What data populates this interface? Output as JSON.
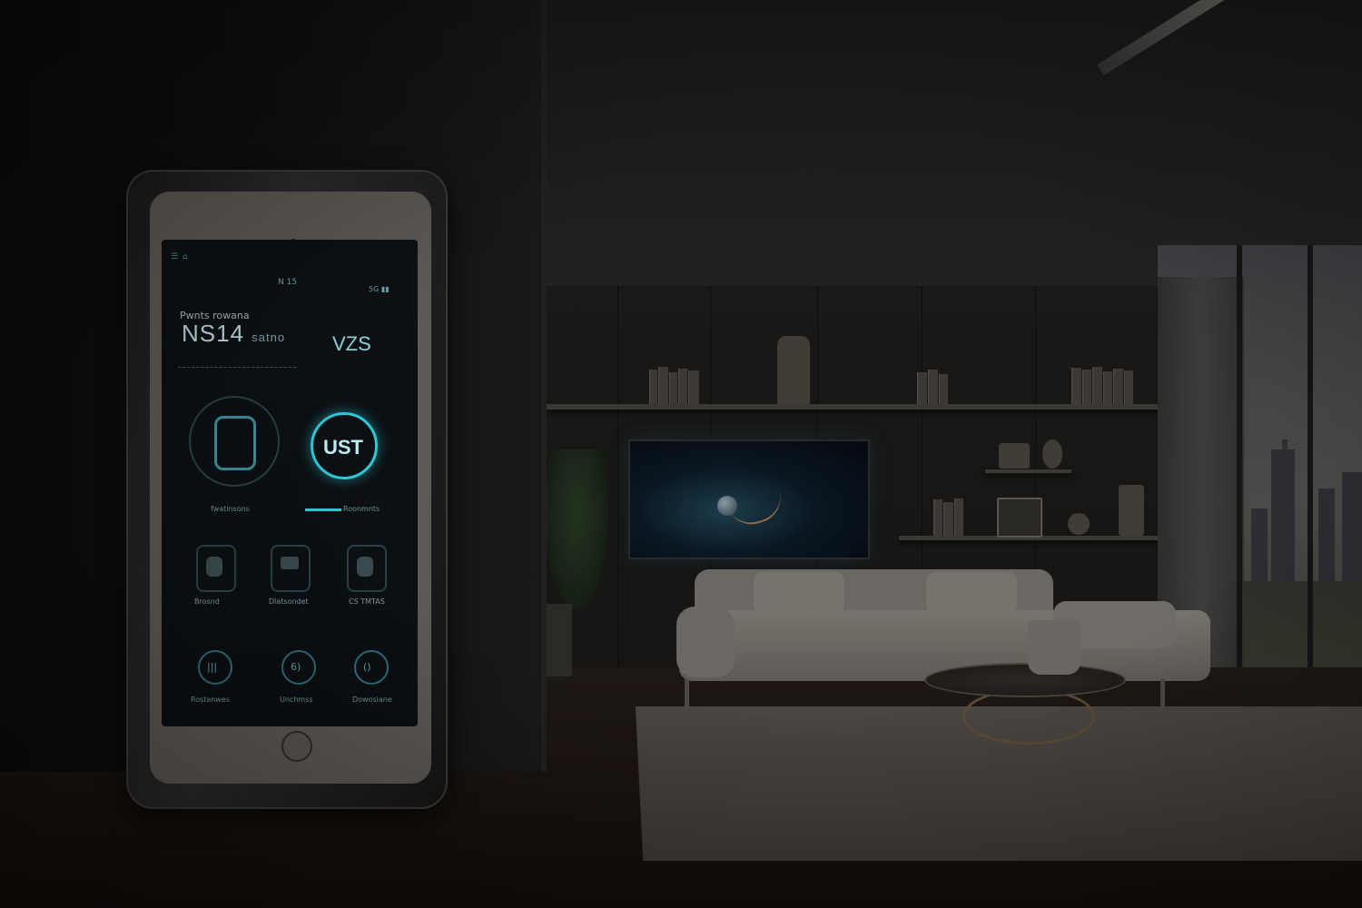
{
  "tablet": {
    "status_left": "☰ ⌂",
    "status_center": "N 15",
    "status_right": "5G ▮▮",
    "header": "Pwnts rowana",
    "big_value": "NS14",
    "big_value_suffix": "satno",
    "big_value_right": "VZS",
    "dial_left_caption": "fwatinsons",
    "dial_right_text": "UST",
    "dial_right_caption": "Roonmnts",
    "tiles": [
      {
        "caption": "Brosnd"
      },
      {
        "caption": "Dlatsondet"
      },
      {
        "caption": "CS TMTAS"
      }
    ],
    "bottom_icons": [
      {
        "glyph": "|||",
        "caption": "Rostanwes"
      },
      {
        "glyph": "6)",
        "caption": "Unchmss"
      },
      {
        "glyph": "()",
        "caption": "Dowosiane"
      }
    ]
  },
  "colors": {
    "screen_accent": "#2fc8d6",
    "screen_background": "#0c1114",
    "room_wall": "#1a1917",
    "sofa": "#6b6762"
  }
}
